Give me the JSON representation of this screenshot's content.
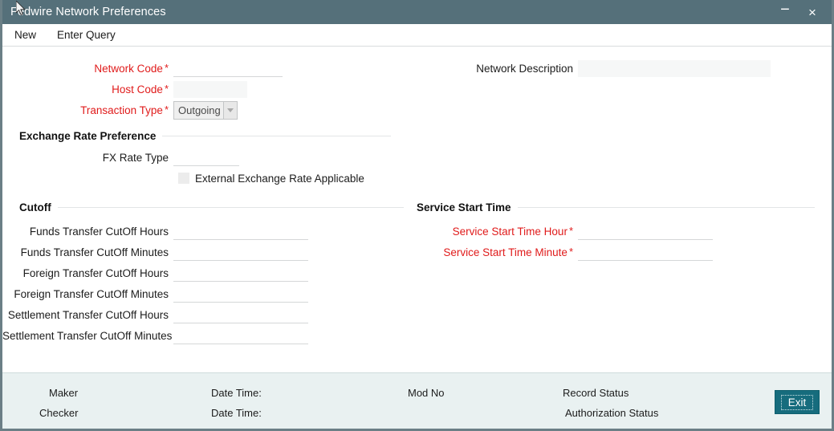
{
  "window": {
    "title": "Fedwire Network Preferences",
    "minimize_label": "−",
    "close_label": "×"
  },
  "menubar": {
    "items": [
      {
        "label": "New"
      },
      {
        "label": "Enter Query"
      }
    ]
  },
  "form": {
    "network_code": {
      "label": "Network Code",
      "required": true,
      "value": "",
      "placeholder": ""
    },
    "host_code": {
      "label": "Host Code",
      "required": true,
      "value": "",
      "placeholder": ""
    },
    "transaction_type": {
      "label": "Transaction Type",
      "required": true,
      "value": "Outgoing",
      "options": [
        "Outgoing"
      ]
    },
    "network_description": {
      "label": "Network Description",
      "required": false,
      "value": "",
      "placeholder": ""
    }
  },
  "exchange_rate_preference": {
    "section_title": "Exchange Rate Preference",
    "fx_rate_type": {
      "label": "FX Rate Type",
      "required": false,
      "value": "",
      "placeholder": ""
    },
    "external_exchange_rate": {
      "label": "External Exchange Rate Applicable",
      "checked": false
    }
  },
  "cutoff": {
    "section_title": "Cutoff",
    "fields": [
      {
        "label": "Funds Transfer CutOff Hours",
        "required": false,
        "value": ""
      },
      {
        "label": "Funds Transfer CutOff Minutes",
        "required": false,
        "value": ""
      },
      {
        "label": "Foreign Transfer CutOff Hours",
        "required": false,
        "value": ""
      },
      {
        "label": "Foreign Transfer CutOff Minutes",
        "required": false,
        "value": ""
      },
      {
        "label": "Settlement Transfer CutOff Hours",
        "required": false,
        "value": ""
      },
      {
        "label": "Settlement Transfer CutOff Minutes",
        "required": false,
        "value": ""
      }
    ]
  },
  "service_start_time": {
    "section_title": "Service Start Time",
    "fields": [
      {
        "label": "Service Start Time Hour",
        "required": true,
        "value": ""
      },
      {
        "label": "Service Start Time Minute",
        "required": true,
        "value": ""
      }
    ]
  },
  "footer": {
    "maker_label": "Maker",
    "maker_value": "",
    "checker_label": "Checker",
    "checker_value": "",
    "date_time_label_1": "Date Time:",
    "date_time_value_1": "",
    "date_time_label_2": "Date Time:",
    "date_time_value_2": "",
    "mod_no_label": "Mod No",
    "mod_no_value": "",
    "record_status_label": "Record Status",
    "record_status_value": "",
    "authorization_status_label": "Authorization Status",
    "authorization_status_value": "",
    "exit_label": "Exit"
  },
  "colors": {
    "titlebar": "#55707a",
    "required": "#e01b1b",
    "footer_bg": "#e9f1f1",
    "exit_button": "#166c7d",
    "window_border": "#6b7f86"
  }
}
